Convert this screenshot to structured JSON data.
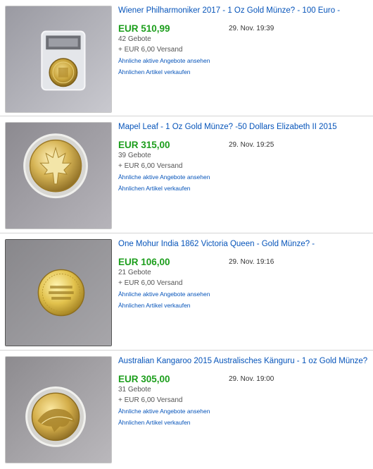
{
  "listings": [
    {
      "title": "Wiener Philharmoniker 2017 - 1 Oz Gold Münze? - 100 Euro -",
      "price": "EUR 510,99",
      "end_date": "29. Nov. 19:39",
      "bids": "42 Gebote",
      "shipping": "+ EUR 6,00 Versand",
      "similar_active": "Ähnliche aktive Angebote ansehen",
      "sell_similar": "Ähnlichen Artikel verkaufen",
      "image_icon": "coin-in-slab-icon"
    },
    {
      "title": "Mapel Leaf - 1 Oz Gold Münze? -50 Dollars Elizabeth II 2015",
      "price": "EUR 315,00",
      "end_date": "29. Nov. 19:25",
      "bids": "39 Gebote",
      "shipping": "+ EUR 6,00 Versand",
      "similar_active": "Ähnliche aktive Angebote ansehen",
      "sell_similar": "Ähnlichen Artikel verkaufen",
      "image_icon": "maple-leaf-coin-icon"
    },
    {
      "title": "One Mohur India 1862 Victoria Queen - Gold Münze? -",
      "price": "EUR 106,00",
      "end_date": "29. Nov. 19:16",
      "bids": "21 Gebote",
      "shipping": "+ EUR 6,00 Versand",
      "similar_active": "Ähnliche aktive Angebote ansehen",
      "sell_similar": "Ähnlichen Artikel verkaufen",
      "image_icon": "small-gold-coin-icon"
    },
    {
      "title": "Australian Kangaroo 2015 Australisches Känguru - 1 oz Gold Münze? -",
      "price": "EUR 305,00",
      "end_date": "29. Nov. 19:00",
      "bids": "31 Gebote",
      "shipping": "+ EUR 6,00 Versand",
      "similar_active": "Ähnliche aktive Angebote ansehen",
      "sell_similar": "Ähnlichen Artikel verkaufen",
      "image_icon": "kangaroo-coin-icon"
    }
  ],
  "colors": {
    "link": "#0654ba",
    "price": "#1c9e1c",
    "divider": "#d4d4d4"
  }
}
